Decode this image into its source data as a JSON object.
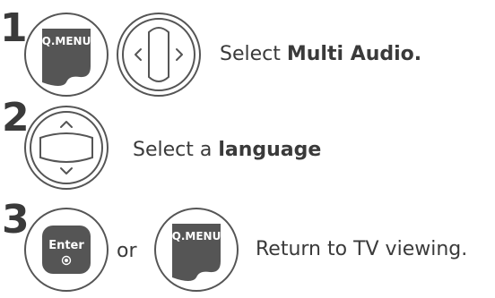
{
  "steps": [
    {
      "number": "1",
      "button_label": "Q.MENU",
      "text_prefix": "Select ",
      "text_bold": "Multi Audio."
    },
    {
      "number": "2",
      "text_prefix": "Select a ",
      "text_bold": "language"
    },
    {
      "number": "3",
      "button_label_enter": "Enter",
      "or_text": "or",
      "button_label_qmenu": "Q.MENU",
      "text": "Return to TV viewing."
    }
  ],
  "icons": [
    "qmenu-button-icon",
    "left-right-navigation-icon",
    "up-down-navigation-icon",
    "enter-button-icon"
  ]
}
